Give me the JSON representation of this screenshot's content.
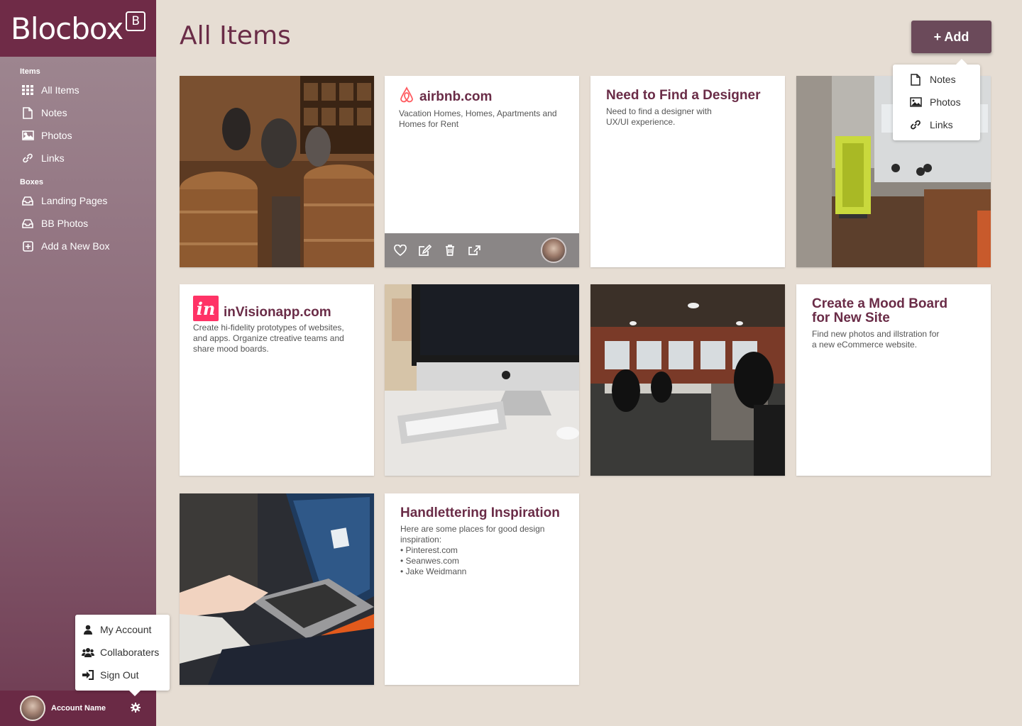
{
  "sidebar": {
    "logo": "Blocbox",
    "logo_badge": "B",
    "items_title": "Items",
    "items": [
      {
        "label": "All Items",
        "icon": "grid-icon"
      },
      {
        "label": "Notes",
        "icon": "document-icon"
      },
      {
        "label": "Photos",
        "icon": "image-icon"
      },
      {
        "label": "Links",
        "icon": "link-icon"
      }
    ],
    "boxes_title": "Boxes",
    "boxes": [
      {
        "label": "Landing Pages",
        "icon": "inbox-icon"
      },
      {
        "label": "BB Photos",
        "icon": "inbox-icon"
      },
      {
        "label": "Add a New Box",
        "icon": "plus-square-icon"
      }
    ],
    "account_name": "Account Name"
  },
  "account_menu": {
    "items": [
      {
        "label": "My Account",
        "icon": "user-icon"
      },
      {
        "label": "Collaboraters",
        "icon": "users-icon"
      },
      {
        "label": "Sign Out",
        "icon": "sign-out-icon"
      }
    ]
  },
  "header": {
    "title": "All Items",
    "add_label": "+ Add"
  },
  "add_menu": {
    "items": [
      {
        "label": "Notes",
        "icon": "document-icon"
      },
      {
        "label": "Photos",
        "icon": "image-icon"
      },
      {
        "label": "Links",
        "icon": "link-icon"
      }
    ]
  },
  "cards": {
    "airbnb": {
      "title": "airbnb.com",
      "body": "Vacation Homes, Homes, Apartments and Homes for Rent",
      "brand_color": "#ff5a5f"
    },
    "designer": {
      "title": "Need to Find a Designer",
      "body": "Need to find a designer with UX/UI experience."
    },
    "invision": {
      "title": "inVisionapp.com",
      "logo": "in",
      "body": "Create hi-fidelity prototypes of websites, and apps. Organize ctreative teams and share mood boards.",
      "brand_color": "#ff3366"
    },
    "moodboard": {
      "title": "Create a Mood Board for New Site",
      "body": "Find new photos and illstration for a new eCommerce website."
    },
    "handlettering": {
      "title": "Handlettering Inspiration",
      "intro": "Here are some places for good design inspiration:",
      "list": [
        "• Pinterest.com",
        "• Seanwes.com",
        "• Jake Weidmann"
      ]
    }
  },
  "colors": {
    "accent": "#6a2c47",
    "background": "#e6ddd3",
    "sidebar_top": "#6f2b47"
  }
}
